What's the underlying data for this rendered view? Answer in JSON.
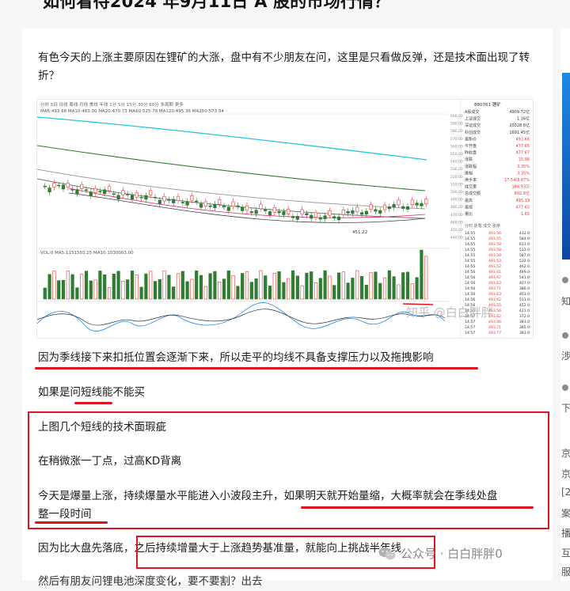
{
  "article": {
    "title": "如何看待2024 年9月11日 A 股的市场行情？",
    "paragraphs": {
      "p1": "有色今天的上涨主要原因在锂矿的大涨，盘中有不少朋友在问，这里是只看做反弹，还是技术面出现了转折？",
      "p2": "因为季线接下来扣抵位置会逐渐下来，所以走平的均线不具备支撑压力以及拖拽影响",
      "p3": "如果是问短线能不能买",
      "p4": "上图几个短线的技术面瑕疵",
      "p5": "在稍微涨一丁点，过高KD背离",
      "p6a": "今天是爆量上涨，持续爆量水平能进入小波段主升，如果明天就开始量缩，大概率就会在季线处盘",
      "p6b": "整一段时间",
      "p7": "因为比大盘先落底，之后持续增量大于上涨趋势基准量，就能向上挑战半年线",
      "p8": "然后有朋友问锂电池深度变化，要不要割？出去"
    }
  },
  "chart_image": {
    "toolbar": "分时  5日  日线  周线  月线  季线  年线  1分  5分  15分  30分  60分  多周期  更多",
    "ma_legend": "MA5:493.68  MA10:483.00  MA20:470.73  MA60:525.78  MA120:495.36  MA250:573.54",
    "vol_legend": "VOL:0  MA5:1151503.25  MA10:1030003.00",
    "price_labels": [
      "600.00",
      "590.00",
      "580.00",
      "570.00",
      "560.00",
      "550.00",
      "540.00",
      "530.00",
      "520.00",
      "510.00",
      "500.00",
      "490.00",
      "480.00",
      "470.00",
      "460.00",
      "450.00",
      "440.00"
    ],
    "low_label": "451.22",
    "panel_title": "880761 锂矿",
    "panel_rows": [
      [
        "A股成交",
        "4909.72亿"
      ],
      [
        "上证成交",
        "1.16亿"
      ],
      [
        "深证成交",
        "20328.6亿"
      ],
      [
        "科创成交",
        "1691.45亿"
      ],
      [
        "最新价",
        "493.66"
      ],
      [
        "今开盘",
        "477.65"
      ],
      [
        "昨收盘",
        "477.67"
      ],
      [
        "涨跌",
        "15.98"
      ],
      [
        "涨跌幅",
        "3.35%"
      ],
      [
        "振幅",
        "3.35%"
      ],
      [
        "换手率",
        "17.54/3.67%"
      ],
      [
        "成交量",
        "184.93万"
      ],
      [
        "总成交额",
        "892.8亿"
      ],
      [
        "最高",
        "495.19"
      ],
      [
        "最低",
        "477.65"
      ],
      [
        "量比",
        "1.65"
      ]
    ],
    "panel_tabs": "分时  逐笔  成交  涨停",
    "tick_times": [
      "14:55",
      "14:55",
      "14:55",
      "14:55",
      "14:55",
      "14:55",
      "14:55",
      "14:56",
      "14:56",
      "14:56",
      "14:56",
      "14:56",
      "14:56",
      "14:56",
      "14:56",
      "14:57",
      "14:57",
      "14:57",
      "14:57"
    ],
    "tick_prices": [
      "493.56",
      "493.55",
      "493.58",
      "493.58",
      "493.59",
      "493.53",
      "493.52",
      "493.61",
      "493.67",
      "493.63",
      "493.71",
      "493.63",
      "493.62",
      "493.55",
      "493.56",
      "493.62",
      "493.66",
      "493.71",
      "493.77"
    ],
    "tick_vols": [
      "432.0",
      "584.0",
      "611.0",
      "533.0",
      "587.0",
      "532.0",
      "462.0",
      "499.0",
      "541.0",
      "407.0",
      "386.0",
      "403.0",
      "511.0",
      "452.0",
      "421.0",
      "372.0",
      "383.0",
      "385.0",
      "383.0"
    ],
    "watermark": "知乎 @白白胖胖"
  },
  "watermark": {
    "brand": "公众号 · 白白胖胖0"
  },
  "side_chars": [
    "知",
    "涉",
    "下",
    "京",
    "京",
    "[2",
    "案",
    "播",
    "互",
    "服"
  ]
}
